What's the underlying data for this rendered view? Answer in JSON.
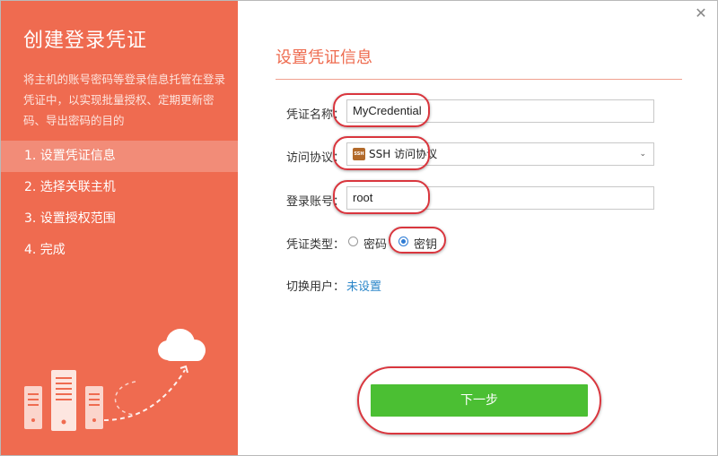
{
  "left": {
    "title": "创建登录凭证",
    "description": "将主机的账号密码等登录信息托管在登录凭证中，以实现批量授权、定期更新密码、导出密码的目的",
    "steps": [
      {
        "label": "1. 设置凭证信息",
        "active": true
      },
      {
        "label": "2. 选择关联主机",
        "active": false
      },
      {
        "label": "3. 设置授权范围",
        "active": false
      },
      {
        "label": "4. 完成",
        "active": false
      }
    ]
  },
  "header": {
    "close_icon": "close-icon",
    "close_glyph": "✕"
  },
  "form": {
    "section_title": "设置凭证信息",
    "name": {
      "label": "凭证名称：",
      "value": "MyCredential"
    },
    "protocol": {
      "label": "访问协议：",
      "icon": "ssh-icon",
      "icon_text": "SSH",
      "value": "SSH 访问协议",
      "chevron": "⌄"
    },
    "account": {
      "label": "登录账号：",
      "value": "root"
    },
    "cred_type": {
      "label": "凭证类型：",
      "options": [
        {
          "label": "密码",
          "checked": false
        },
        {
          "label": "密钥",
          "checked": true
        }
      ]
    },
    "switch_user": {
      "label": "切换用户：",
      "value": "未设置"
    }
  },
  "actions": {
    "next_label": "下一步"
  },
  "colors": {
    "accent": "#ef6b50",
    "next_button": "#4bbf33",
    "link": "#2a86c9",
    "annotation": "#d9363e"
  }
}
